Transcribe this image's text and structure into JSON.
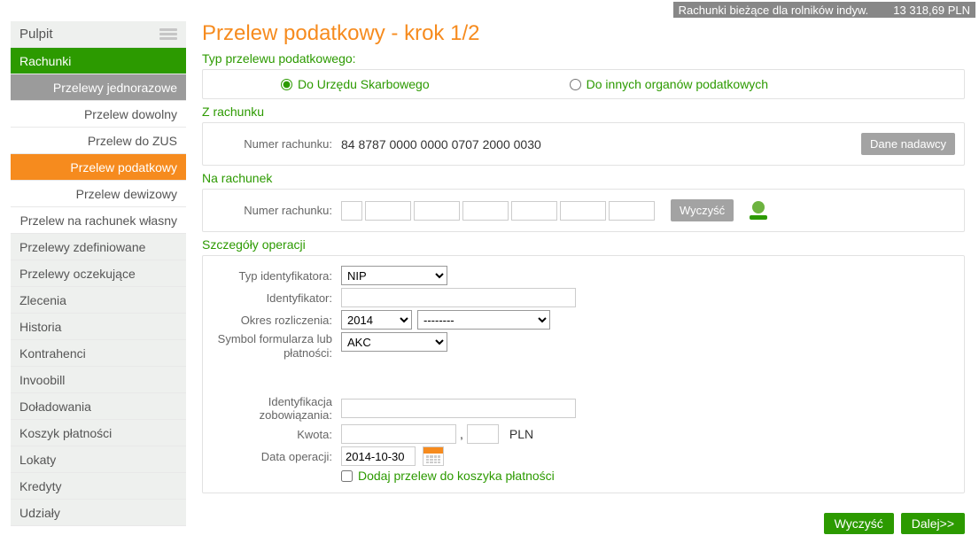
{
  "ribbon": {
    "label": "Rachunki bieżące dla rolników indyw.",
    "amount": "13 318,69 PLN"
  },
  "sidebar": {
    "head": "Pulpit",
    "items": [
      {
        "label": "Rachunki",
        "cls": "active-green"
      },
      {
        "label": "Przelewy jednorazowe",
        "cls": "sub-grey"
      },
      {
        "label": "Przelew dowolny",
        "cls": "sub-white"
      },
      {
        "label": "Przelew do ZUS",
        "cls": "sub-white"
      },
      {
        "label": "Przelew podatkowy",
        "cls": "sub-orange"
      },
      {
        "label": "Przelew dewizowy",
        "cls": "sub-white"
      },
      {
        "label": "Przelew na rachunek własny",
        "cls": "sub-white"
      },
      {
        "label": "Przelewy zdefiniowane",
        "cls": ""
      },
      {
        "label": "Przelewy oczekujące",
        "cls": ""
      },
      {
        "label": "Zlecenia",
        "cls": ""
      },
      {
        "label": "Historia",
        "cls": ""
      },
      {
        "label": "Kontrahenci",
        "cls": ""
      },
      {
        "label": "Invoobill",
        "cls": ""
      },
      {
        "label": "Doładowania",
        "cls": ""
      },
      {
        "label": "Koszyk płatności",
        "cls": ""
      },
      {
        "label": "Lokaty",
        "cls": ""
      },
      {
        "label": "Kredyty",
        "cls": ""
      },
      {
        "label": "Udziały",
        "cls": ""
      }
    ]
  },
  "page": {
    "title": "Przelew podatkowy - krok 1/2",
    "sections": {
      "transferType": "Typ przelewu podatkowego:",
      "fromAccount": "Z rachunku",
      "toAccount": "Na rachunek",
      "details": "Szczegóły operacji"
    }
  },
  "radio": {
    "opt1": "Do Urzędu Skarbowego",
    "opt2": "Do innych organów podatkowych"
  },
  "from": {
    "label": "Numer rachunku:",
    "value": "84 8787 0000 0000 0707 2000 0030",
    "senderBtn": "Dane nadawcy"
  },
  "to": {
    "label": "Numer rachunku:",
    "clearBtn": "Wyczyść"
  },
  "details": {
    "idTypeLabel": "Typ identyfikatora:",
    "idType": "NIP",
    "idLabel": "Identyfikator:",
    "periodLabel": "Okres rozliczenia:",
    "periodYear": "2014",
    "periodDetail": "--------",
    "symbolLabel": "Symbol formularza lub płatności:",
    "symbol": "AKC",
    "oblLabel": "Identyfikacja zobowiązania:",
    "amountLabel": "Kwota:",
    "currency": "PLN",
    "dateLabel": "Data operacji:",
    "date": "2014-10-30",
    "basketLabel": "Dodaj przelew do koszyka płatności"
  },
  "footer": {
    "clear": "Wyczyść",
    "next": "Dalej>>"
  }
}
